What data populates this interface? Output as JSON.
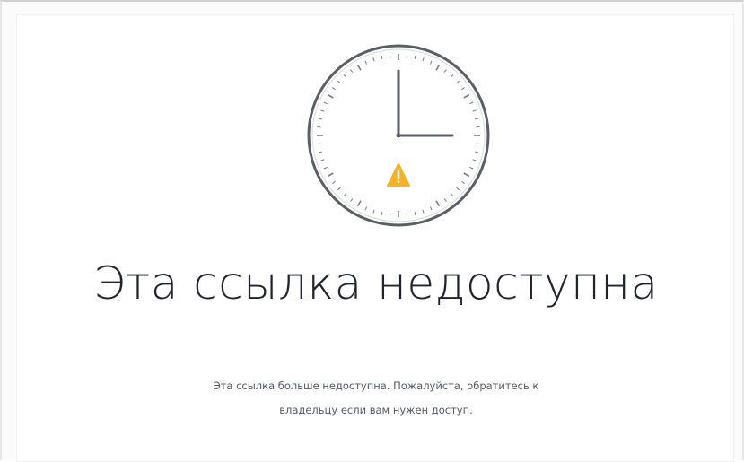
{
  "page": {
    "headline": "Эта ссылка недоступна",
    "message_line1": "Эта ссылка больше недоступна. Пожалуйста, обратитесь к",
    "message_line2": "владельцу если вам нужен доступ."
  },
  "illustration": {
    "icon": "clock-icon",
    "warning_icon": "warning-triangle-icon",
    "clock_time": "3:00"
  },
  "colors": {
    "clock_outline": "#5b5e66",
    "clock_ticks": "#7a7d84",
    "warning": "#f5b324",
    "text_dark": "#20232a",
    "text_muted": "#555a60",
    "background": "#ffffff"
  }
}
